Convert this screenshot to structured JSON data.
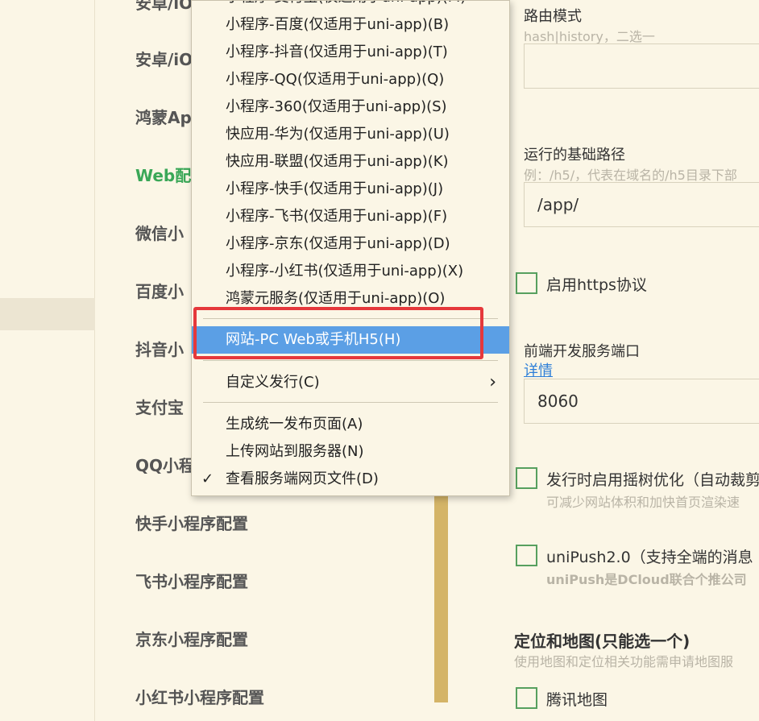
{
  "left_strip": {},
  "nav": {
    "items": [
      {
        "label": "安卓/iO"
      },
      {
        "label": "安卓/iO"
      },
      {
        "label": "鸿蒙Ap"
      },
      {
        "label": "Web配"
      },
      {
        "label": "微信小"
      },
      {
        "label": "百度小"
      },
      {
        "label": "抖音小"
      },
      {
        "label": "支付宝"
      },
      {
        "label": "QQ小程"
      },
      {
        "label": "快手小程序配置"
      },
      {
        "label": "飞书小程序配置"
      },
      {
        "label": "京东小程序配置"
      },
      {
        "label": "小红书小程序配置"
      }
    ],
    "active_color": "#3aa757"
  },
  "panel": {
    "route_mode": {
      "label": "路由模式",
      "hint": "hash|history，二选一",
      "value": ""
    },
    "base_path": {
      "label": "运行的基础路径",
      "hint": "例：/h5/，代表在域名的/h5目录下部",
      "value": "/app/"
    },
    "https": {
      "label": "启用https协议"
    },
    "dev_port": {
      "label": "前端开发服务端口",
      "link": "详情",
      "value": "8060"
    },
    "tree_shaking": {
      "label": "发行时启用摇树优化（自动裁剪",
      "hint": "可减少网站体积和加快首页渲染速"
    },
    "unipush": {
      "label": "uniPush2.0（支持全端的消息",
      "hint": "uniPush是DCloud联合个推公司"
    },
    "map_section": {
      "title": "定位和地图(只能选一个)",
      "hint": "使用地图和定位相关功能需申请地图服"
    },
    "tencent_map": {
      "label": "腾讯地图"
    }
  },
  "menu": {
    "items": [
      {
        "label": "小程序-支付宝(仅适用于uni-app)(M)"
      },
      {
        "label": "小程序-百度(仅适用于uni-app)(B)"
      },
      {
        "label": "小程序-抖音(仅适用于uni-app)(T)"
      },
      {
        "label": "小程序-QQ(仅适用于uni-app)(Q)"
      },
      {
        "label": "小程序-360(仅适用于uni-app)(S)"
      },
      {
        "label": "快应用-华为(仅适用于uni-app)(U)"
      },
      {
        "label": "快应用-联盟(仅适用于uni-app)(K)"
      },
      {
        "label": "小程序-快手(仅适用于uni-app)(J)"
      },
      {
        "label": "小程序-飞书(仅适用于uni-app)(F)"
      },
      {
        "label": "小程序-京东(仅适用于uni-app)(D)"
      },
      {
        "label": "小程序-小红书(仅适用于uni-app)(X)"
      },
      {
        "label": "鸿蒙元服务(仅适用于uni-app)(O)"
      }
    ],
    "selected": {
      "label": "网站-PC Web或手机H5(H)"
    },
    "custom_publish": {
      "label": "自定义发行(C)",
      "arrow": "›"
    },
    "generate_page": {
      "label": "生成统一发布页面(A)"
    },
    "upload_site": {
      "label": "上传网站到服务器(N)"
    },
    "view_files": {
      "label": "查看服务端网页文件(D)",
      "check": "✓"
    },
    "highlight_color": "#5b9fe5",
    "annotation_color": "#e5383b"
  }
}
